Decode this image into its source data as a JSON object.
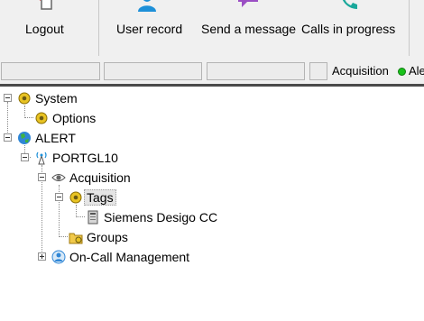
{
  "toolbar": {
    "buttons": [
      {
        "label": "Logout",
        "icon": "logout-icon"
      },
      {
        "label": "User record",
        "icon": "user-record-icon"
      },
      {
        "label": "Send a message",
        "icon": "message-icon"
      },
      {
        "label": "Calls in progress",
        "icon": "phone-icon"
      }
    ]
  },
  "statusbar": {
    "acquisition_label": "Acquisition",
    "alert_label": "Ale",
    "status_color": "#19c21b"
  },
  "tree": {
    "system": "System",
    "options": "Options",
    "alert": "ALERT",
    "portgl10": "PORTGL10",
    "acquisition": "Acquisition",
    "tags": "Tags",
    "siemens": "Siemens Desigo CC",
    "groups": "Groups",
    "oncall": "On-Call Management"
  },
  "colors": {
    "accent_blue": "#1e90d8",
    "message_purple": "#9b4fc4",
    "call_teal": "#1aa89b",
    "logout_red": "#e0262a"
  }
}
